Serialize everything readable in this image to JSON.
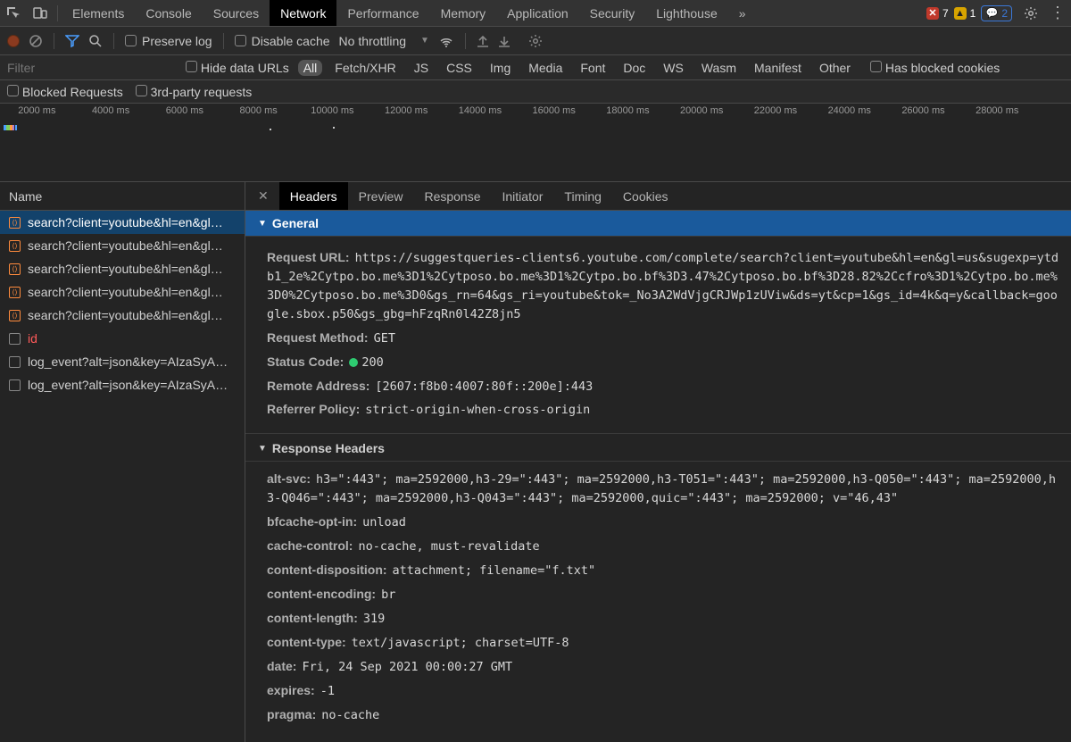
{
  "tabs": {
    "items": [
      "Elements",
      "Console",
      "Sources",
      "Network",
      "Performance",
      "Memory",
      "Application",
      "Security",
      "Lighthouse"
    ],
    "active": "Network",
    "overflow": "»"
  },
  "status": {
    "errors": "7",
    "warnings": "1",
    "messages": "2"
  },
  "toolbar": {
    "preserve_log": "Preserve log",
    "disable_cache": "Disable cache",
    "throttling": "No throttling"
  },
  "filterbar": {
    "placeholder": "Filter",
    "hide_data_urls": "Hide data URLs",
    "types": [
      "All",
      "Fetch/XHR",
      "JS",
      "CSS",
      "Img",
      "Media",
      "Font",
      "Doc",
      "WS",
      "Wasm",
      "Manifest",
      "Other"
    ],
    "active_type": "All",
    "has_blocked": "Has blocked cookies"
  },
  "filterrow2": {
    "blocked": "Blocked Requests",
    "third_party": "3rd-party requests"
  },
  "timeline": {
    "ticks": [
      "2000 ms",
      "4000 ms",
      "6000 ms",
      "8000 ms",
      "10000 ms",
      "12000 ms",
      "14000 ms",
      "16000 ms",
      "18000 ms",
      "20000 ms",
      "22000 ms",
      "24000 ms",
      "26000 ms",
      "28000 ms"
    ]
  },
  "requests": {
    "header": "Name",
    "items": [
      {
        "label": "search?client=youtube&hl=en&gl…",
        "icon": "script",
        "selected": true
      },
      {
        "label": "search?client=youtube&hl=en&gl…",
        "icon": "script"
      },
      {
        "label": "search?client=youtube&hl=en&gl…",
        "icon": "script"
      },
      {
        "label": "search?client=youtube&hl=en&gl…",
        "icon": "script"
      },
      {
        "label": "search?client=youtube&hl=en&gl…",
        "icon": "script"
      },
      {
        "label": "id",
        "icon": "doc",
        "red": true
      },
      {
        "label": "log_event?alt=json&key=AIzaSyA…",
        "icon": "doc"
      },
      {
        "label": "log_event?alt=json&key=AIzaSyA…",
        "icon": "doc"
      }
    ]
  },
  "detail_tabs": {
    "items": [
      "Headers",
      "Preview",
      "Response",
      "Initiator",
      "Timing",
      "Cookies"
    ],
    "active": "Headers"
  },
  "general": {
    "title": "General",
    "request_url_label": "Request URL:",
    "request_url": "https://suggestqueries-clients6.youtube.com/complete/search?client=youtube&hl=en&gl=us&sugexp=ytdb1_2e%2Cytpo.bo.me%3D1%2Cytposo.bo.me%3D1%2Cytpo.bo.bf%3D3.47%2Cytposo.bo.bf%3D28.82%2Ccfro%3D1%2Cytpo.bo.me%3D0%2Cytposo.bo.me%3D0&gs_rn=64&gs_ri=youtube&tok=_No3A2WdVjgCRJWp1zUViw&ds=yt&cp=1&gs_id=4k&q=y&callback=google.sbox.p50&gs_gbg=hFzqRn0l42Z8jn5",
    "method_label": "Request Method:",
    "method": "GET",
    "status_label": "Status Code:",
    "status": "200",
    "remote_label": "Remote Address:",
    "remote": "[2607:f8b0:4007:80f::200e]:443",
    "referrer_label": "Referrer Policy:",
    "referrer": "strict-origin-when-cross-origin"
  },
  "response_headers": {
    "title": "Response Headers",
    "items": [
      {
        "k": "alt-svc:",
        "v": "h3=\":443\"; ma=2592000,h3-29=\":443\"; ma=2592000,h3-T051=\":443\"; ma=2592000,h3-Q050=\":443\"; ma=2592000,h3-Q046=\":443\"; ma=2592000,h3-Q043=\":443\"; ma=2592000,quic=\":443\"; ma=2592000; v=\"46,43\""
      },
      {
        "k": "bfcache-opt-in:",
        "v": "unload"
      },
      {
        "k": "cache-control:",
        "v": "no-cache, must-revalidate"
      },
      {
        "k": "content-disposition:",
        "v": "attachment; filename=\"f.txt\""
      },
      {
        "k": "content-encoding:",
        "v": "br"
      },
      {
        "k": "content-length:",
        "v": "319"
      },
      {
        "k": "content-type:",
        "v": "text/javascript; charset=UTF-8"
      },
      {
        "k": "date:",
        "v": "Fri, 24 Sep 2021 00:00:27 GMT"
      },
      {
        "k": "expires:",
        "v": "-1"
      },
      {
        "k": "pragma:",
        "v": "no-cache"
      }
    ]
  }
}
